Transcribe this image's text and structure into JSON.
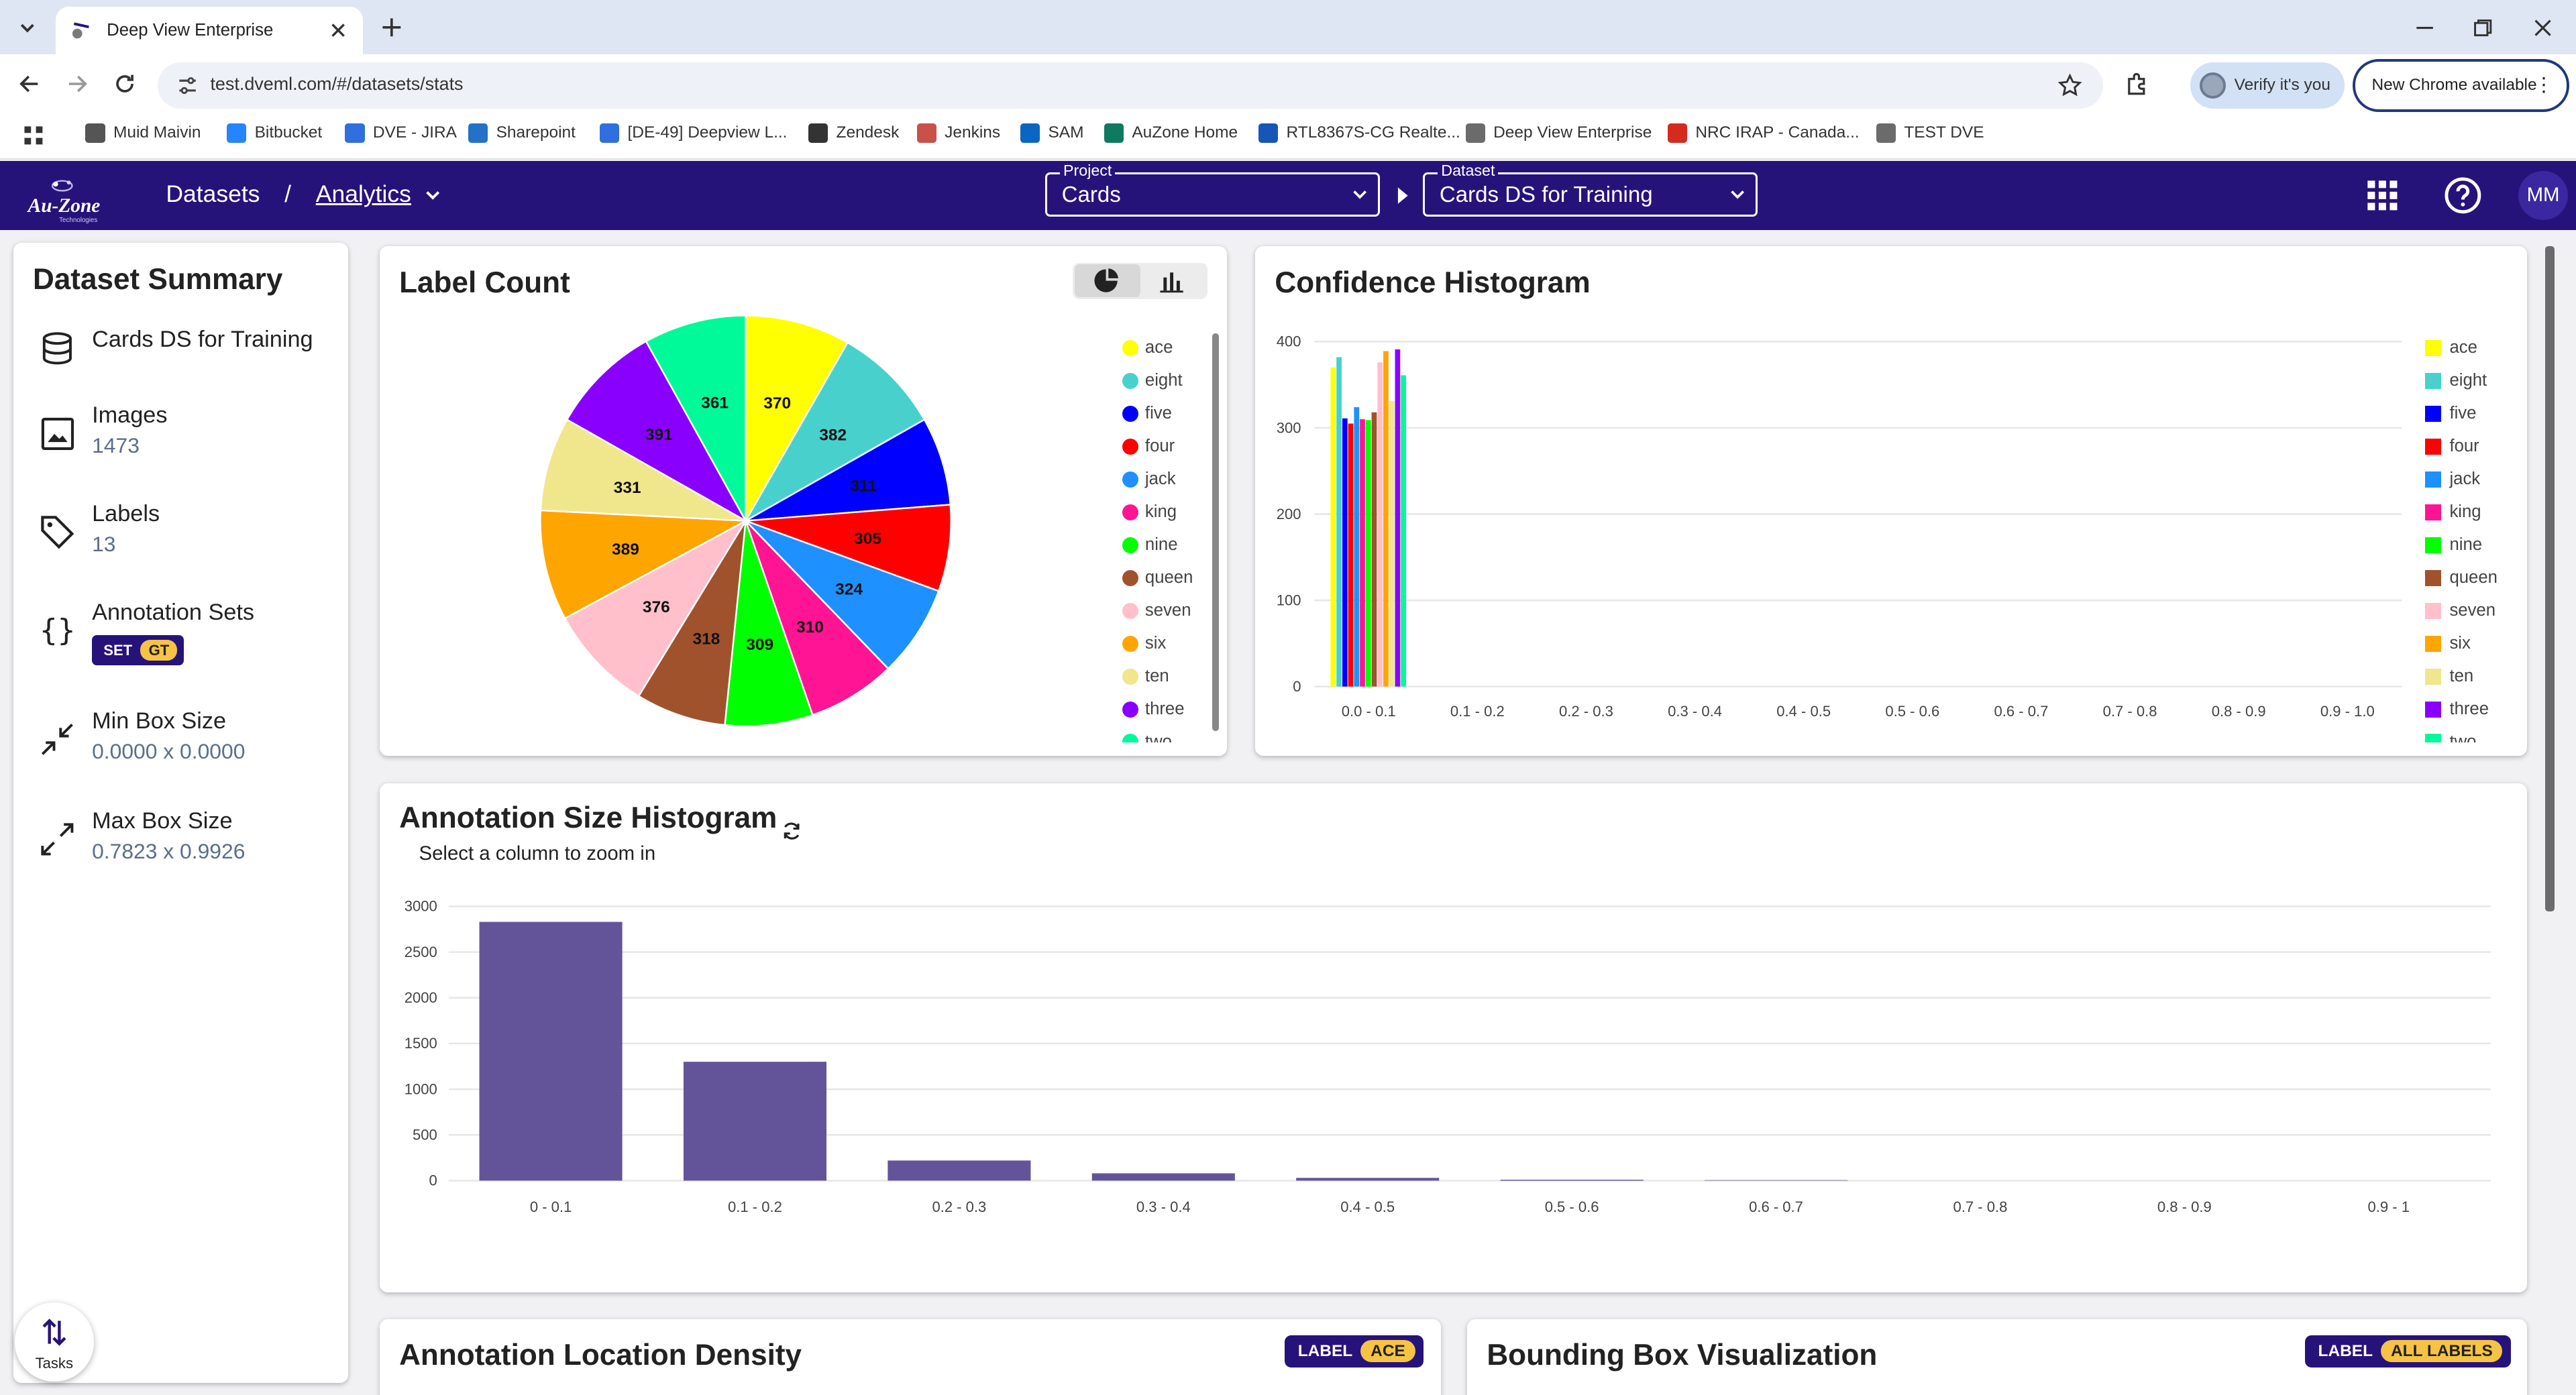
{
  "browser": {
    "tab_title": "Deep View Enterprise",
    "url": "test.dveml.com/#/datasets/stats",
    "verify_label": "Verify it's you",
    "new_chrome_label": "New Chrome available",
    "bookmarks": [
      {
        "label": "Muid Maivin",
        "color": "#555555"
      },
      {
        "label": "Bitbucket",
        "color": "#2684ff"
      },
      {
        "label": "DVE - JIRA",
        "color": "#2f6fde"
      },
      {
        "label": "Sharepoint",
        "color": "#2372c8"
      },
      {
        "label": "[DE-49] Deepview L...",
        "color": "#2f6fde"
      },
      {
        "label": "Zendesk",
        "color": "#333333"
      },
      {
        "label": "Jenkins",
        "color": "#c8514a"
      },
      {
        "label": "SAM",
        "color": "#0a66c2"
      },
      {
        "label": "AuZone Home",
        "color": "#0e7a5f"
      },
      {
        "label": "RTL8367S-CG Realte...",
        "color": "#1656b7"
      },
      {
        "label": "Deep View Enterprise",
        "color": "#6b6b6b"
      },
      {
        "label": "NRC IRAP - Canada...",
        "color": "#d52b1e"
      },
      {
        "label": "TEST DVE",
        "color": "#6b6b6b"
      }
    ]
  },
  "appbar": {
    "logo_text": "Au-Zone",
    "logo_sub": "Technologies",
    "crumb_datasets": "Datasets",
    "crumb_sep": "/",
    "crumb_analytics": "Analytics",
    "project_label": "Project",
    "project_value": "Cards",
    "dataset_label": "Dataset",
    "dataset_value": "Cards DS for Training",
    "user_initials": "MM",
    "accent": "#26137a"
  },
  "summary": {
    "title": "Dataset Summary",
    "dataset_name": "Cards DS for Training",
    "images_label": "Images",
    "images_value": "1473",
    "labels_label": "Labels",
    "labels_value": "13",
    "annotation_sets_label": "Annotation Sets",
    "set_badge": "SET",
    "set_value": "GT",
    "min_box_label": "Min Box Size",
    "min_box_value": "0.0000 x 0.0000",
    "max_box_label": "Max Box Size",
    "max_box_value": "0.7823 x 0.9926",
    "tasks_label": "Tasks"
  },
  "label_count": {
    "title": "Label Count",
    "legend_tail": "two"
  },
  "confidence": {
    "title": "Confidence Histogram"
  },
  "annotation_size": {
    "title": "Annotation Size Histogram",
    "subtitle": "Select a column to zoom in"
  },
  "location_density": {
    "title": "Annotation Location Density",
    "label_tag": "LABEL",
    "label_value": "ACE"
  },
  "bbox_vis": {
    "title": "Bounding Box Visualization",
    "label_tag": "LABEL",
    "label_value": "ALL LABELS"
  },
  "chart_data": [
    {
      "type": "pie",
      "title": "Label Count",
      "categories": [
        "ace",
        "eight",
        "five",
        "four",
        "jack",
        "king",
        "nine",
        "queen",
        "seven",
        "six",
        "ten",
        "three",
        "two"
      ],
      "values": [
        370,
        382,
        311,
        305,
        324,
        310,
        309,
        318,
        376,
        389,
        331,
        391,
        361
      ],
      "colors": [
        "#ffff00",
        "#48d1cc",
        "#0000ff",
        "#ff0000",
        "#1e90ff",
        "#ff1493",
        "#00ff00",
        "#a0522d",
        "#ffc0cb",
        "#ffa500",
        "#f0e68c",
        "#8a00ff",
        "#00fa9a"
      ]
    },
    {
      "type": "bar",
      "title": "Confidence Histogram",
      "categories": [
        "0.0 - 0.1",
        "0.1 - 0.2",
        "0.2 - 0.3",
        "0.3 - 0.4",
        "0.4 - 0.5",
        "0.5 - 0.6",
        "0.6 - 0.7",
        "0.7 - 0.8",
        "0.8 - 0.9",
        "0.9 - 1.0"
      ],
      "ylim": [
        0,
        400
      ],
      "yticks": [
        0,
        100,
        200,
        300,
        400
      ],
      "series": [
        {
          "name": "ace",
          "values": [
            370,
            0,
            0,
            0,
            0,
            0,
            0,
            0,
            0,
            0
          ]
        },
        {
          "name": "eight",
          "values": [
            382,
            0,
            0,
            0,
            0,
            0,
            0,
            0,
            0,
            0
          ]
        },
        {
          "name": "five",
          "values": [
            311,
            0,
            0,
            0,
            0,
            0,
            0,
            0,
            0,
            0
          ]
        },
        {
          "name": "four",
          "values": [
            305,
            0,
            0,
            0,
            0,
            0,
            0,
            0,
            0,
            0
          ]
        },
        {
          "name": "jack",
          "values": [
            324,
            0,
            0,
            0,
            0,
            0,
            0,
            0,
            0,
            0
          ]
        },
        {
          "name": "king",
          "values": [
            310,
            0,
            0,
            0,
            0,
            0,
            0,
            0,
            0,
            0
          ]
        },
        {
          "name": "nine",
          "values": [
            309,
            0,
            0,
            0,
            0,
            0,
            0,
            0,
            0,
            0
          ]
        },
        {
          "name": "queen",
          "values": [
            318,
            0,
            0,
            0,
            0,
            0,
            0,
            0,
            0,
            0
          ]
        },
        {
          "name": "seven",
          "values": [
            376,
            0,
            0,
            0,
            0,
            0,
            0,
            0,
            0,
            0
          ]
        },
        {
          "name": "six",
          "values": [
            389,
            0,
            0,
            0,
            0,
            0,
            0,
            0,
            0,
            0
          ]
        },
        {
          "name": "ten",
          "values": [
            331,
            0,
            0,
            0,
            0,
            0,
            0,
            0,
            0,
            0
          ]
        },
        {
          "name": "three",
          "values": [
            391,
            0,
            0,
            0,
            0,
            0,
            0,
            0,
            0,
            0
          ]
        },
        {
          "name": "two",
          "values": [
            361,
            0,
            0,
            0,
            0,
            0,
            0,
            0,
            0,
            0
          ]
        }
      ],
      "colors": [
        "#ffff00",
        "#48d1cc",
        "#0000ff",
        "#ff0000",
        "#1e90ff",
        "#ff1493",
        "#00ff00",
        "#a0522d",
        "#ffc0cb",
        "#ffa500",
        "#f0e68c",
        "#8a00ff",
        "#00fa9a"
      ],
      "legend": "right"
    },
    {
      "type": "bar",
      "title": "Annotation Size Histogram",
      "categories": [
        "0 - 0.1",
        "0.1 - 0.2",
        "0.2 - 0.3",
        "0.3 - 0.4",
        "0.4 - 0.5",
        "0.5 - 0.6",
        "0.6 - 0.7",
        "0.7 - 0.8",
        "0.8 - 0.9",
        "0.9 - 1"
      ],
      "values": [
        2830,
        1300,
        220,
        80,
        30,
        10,
        5,
        0,
        0,
        0
      ],
      "ylim": [
        0,
        3000
      ],
      "yticks": [
        0,
        500,
        1000,
        1500,
        2000,
        2500,
        3000
      ],
      "color": "#63549a"
    }
  ]
}
